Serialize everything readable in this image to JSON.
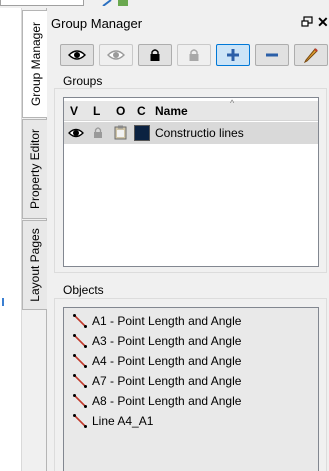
{
  "panel": {
    "title": "Group Manager"
  },
  "tabs": [
    {
      "label": "Group Manager",
      "active": true
    },
    {
      "label": "Property Editor",
      "active": false
    },
    {
      "label": "Layout Pages",
      "active": false
    }
  ],
  "toolbar": {
    "buttons": [
      {
        "icon": "eye-icon",
        "enabled": true
      },
      {
        "icon": "eye-icon",
        "enabled": false
      },
      {
        "icon": "lock-icon",
        "enabled": true
      },
      {
        "icon": "lock-icon",
        "enabled": false
      },
      {
        "icon": "plus-icon",
        "enabled": true,
        "highlighted": true
      },
      {
        "icon": "minus-icon",
        "enabled": true
      },
      {
        "icon": "pencil-icon",
        "enabled": true
      }
    ]
  },
  "groups": {
    "label": "Groups",
    "columns": [
      "V",
      "L",
      "O",
      "C",
      "Name"
    ],
    "rows": [
      {
        "visible_icon": "eye-icon",
        "locked_icon": "lock-icon",
        "object_icon": "clipboard-icon",
        "color": "#0b2241",
        "name": "Constructio lines"
      }
    ]
  },
  "objects": {
    "label": "Objects",
    "items": [
      "A1 - Point Length and Angle",
      "A3 - Point Length and Angle",
      "A4 - Point Length and Angle",
      "A7 - Point Length and Angle",
      "A8 - Point Length and Angle",
      "Line A4_A1"
    ]
  },
  "colors": {
    "accent": "#0078d7",
    "item_icon": "#c0392b"
  }
}
